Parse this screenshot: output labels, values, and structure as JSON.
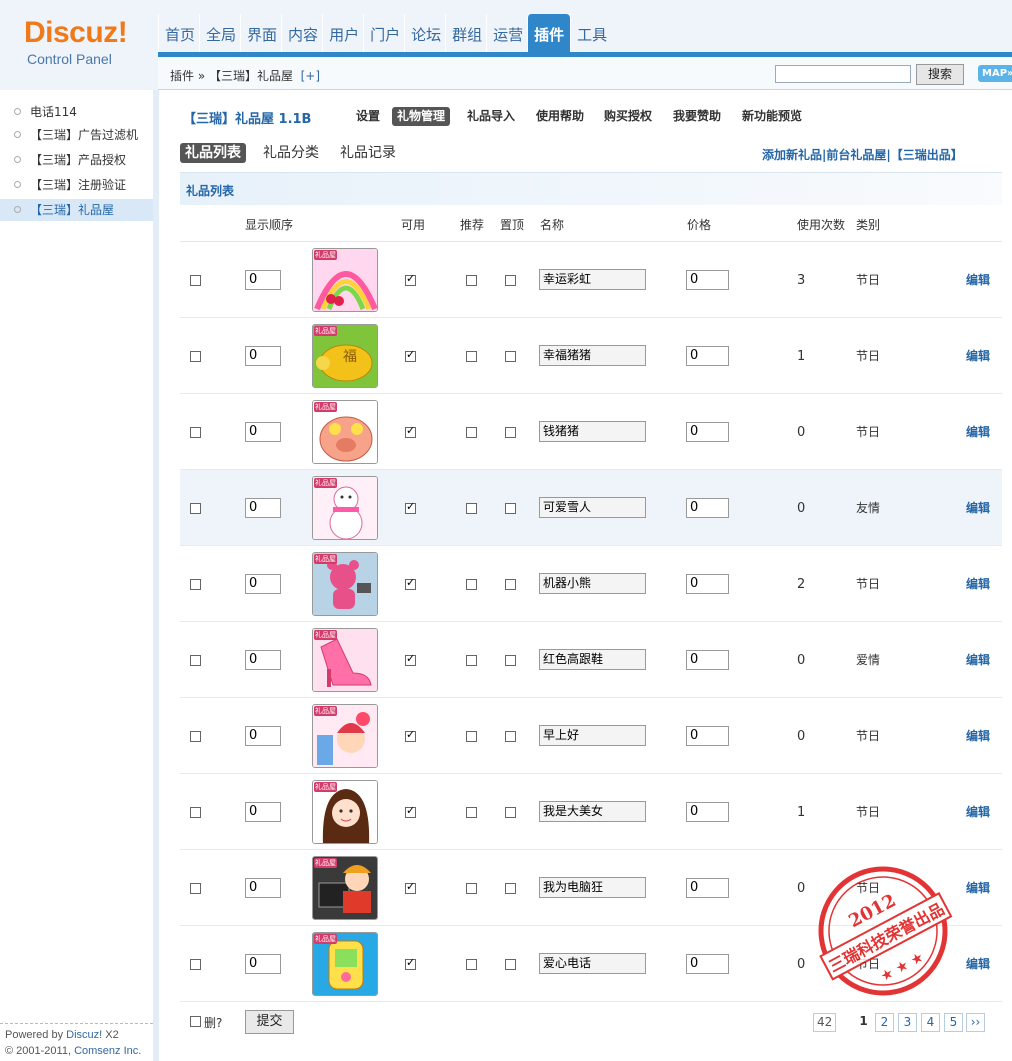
{
  "logo": {
    "main": "Discuz!",
    "sub": "Control Panel"
  },
  "nav": [
    "首页",
    "全局",
    "界面",
    "内容",
    "用户",
    "门户",
    "论坛",
    "群组",
    "运营",
    "插件",
    "工具"
  ],
  "nav_active": "插件",
  "breadcrumb": {
    "text": "插件 » 【三瑞】礼品屋",
    "add": "[+]"
  },
  "search": {
    "button": "搜索",
    "map": "MAP»"
  },
  "sidebar": {
    "items": [
      "电话114",
      "【三瑞】广告过滤机",
      "【三瑞】产品授权",
      "【三瑞】注册验证",
      "【三瑞】礼品屋"
    ],
    "active": "【三瑞】礼品屋"
  },
  "footer": {
    "powered_prefix": "Powered by ",
    "powered_name": "Discuz!",
    "powered_ver": " X2",
    "copy_prefix": "© 2001-2011, ",
    "copy_name": "Comsenz Inc."
  },
  "plugin": {
    "title": "【三瑞】礼品屋  1.1B",
    "tabs": [
      "设置",
      "礼物管理",
      "礼品导入",
      "使用帮助",
      "购买授权",
      "我要赞助",
      "新功能预览"
    ],
    "tab_active": "礼物管理",
    "subtabs": [
      "礼品列表",
      "礼品分类",
      "礼品记录"
    ],
    "subtab_active": "礼品列表",
    "links": "添加新礼品|前台礼品屋|【三瑞出品】"
  },
  "list": {
    "heading": "礼品列表",
    "columns": {
      "order": "显示顺序",
      "enabled": "可用",
      "recommend": "推荐",
      "top": "置顶",
      "name": "名称",
      "price": "价格",
      "uses": "使用次数",
      "category": "类别"
    },
    "rows": [
      {
        "order": "0",
        "enabled": true,
        "recommend": false,
        "top": false,
        "name": "幸运彩虹",
        "price": "0",
        "uses": "3",
        "category": "节日",
        "edit": "编辑",
        "icon": "rainbow-gift"
      },
      {
        "order": "0",
        "enabled": true,
        "recommend": false,
        "top": false,
        "name": "幸福猪猪",
        "price": "0",
        "uses": "1",
        "category": "节日",
        "edit": "编辑",
        "icon": "golden-pig-gift"
      },
      {
        "order": "0",
        "enabled": true,
        "recommend": false,
        "top": false,
        "name": "钱猪猪",
        "price": "0",
        "uses": "0",
        "category": "节日",
        "edit": "编辑",
        "icon": "money-pig-gift"
      },
      {
        "order": "0",
        "enabled": true,
        "recommend": false,
        "top": false,
        "name": "可爱雪人",
        "price": "0",
        "uses": "0",
        "category": "友情",
        "edit": "编辑",
        "icon": "snowman-gift"
      },
      {
        "order": "0",
        "enabled": true,
        "recommend": false,
        "top": false,
        "name": "机器小熊",
        "price": "0",
        "uses": "2",
        "category": "节日",
        "edit": "编辑",
        "icon": "robot-bear-gift"
      },
      {
        "order": "0",
        "enabled": true,
        "recommend": false,
        "top": false,
        "name": "红色高跟鞋",
        "price": "0",
        "uses": "0",
        "category": "爱情",
        "edit": "编辑",
        "icon": "high-heel-gift"
      },
      {
        "order": "0",
        "enabled": true,
        "recommend": false,
        "top": false,
        "name": "早上好",
        "price": "0",
        "uses": "0",
        "category": "节日",
        "edit": "编辑",
        "icon": "good-morning-gift"
      },
      {
        "order": "0",
        "enabled": true,
        "recommend": false,
        "top": false,
        "name": "我是大美女",
        "price": "0",
        "uses": "1",
        "category": "节日",
        "edit": "编辑",
        "icon": "beauty-girl-gift"
      },
      {
        "order": "0",
        "enabled": true,
        "recommend": false,
        "top": false,
        "name": "我为电脑狂",
        "price": "0",
        "uses": "0",
        "category": "节日",
        "edit": "编辑",
        "icon": "computer-fan-gift"
      },
      {
        "order": "0",
        "enabled": true,
        "recommend": false,
        "top": false,
        "name": "爱心电话",
        "price": "0",
        "uses": "0",
        "category": "节日",
        "edit": "编辑",
        "icon": "love-phone-gift"
      }
    ],
    "thumb_tag": "礼品屋"
  },
  "bottom": {
    "delete_label": "删?",
    "submit": "提交",
    "total": "42",
    "pages": [
      "1",
      "2",
      "3",
      "4",
      "5"
    ],
    "current_page": "1",
    "next": "››"
  },
  "stamp": {
    "year": "2012",
    "text": "三瑞科技荣誉出品"
  }
}
